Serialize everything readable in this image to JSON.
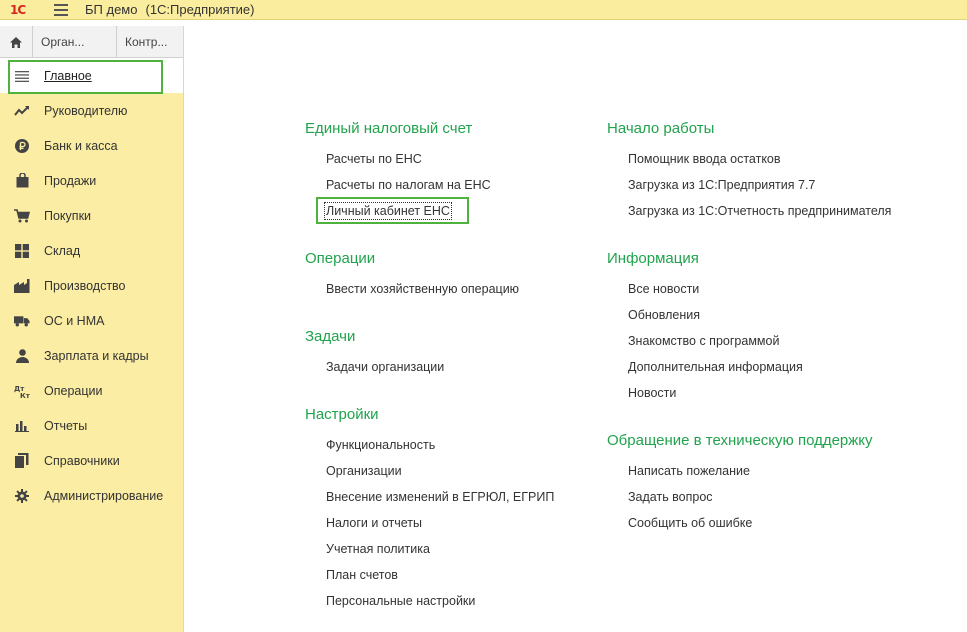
{
  "window": {
    "logo": "1С",
    "title": "БП демо",
    "subtitle": "(1С:Предприятие)"
  },
  "tabs": [
    {
      "label": "Орган..."
    },
    {
      "label": "Контр..."
    }
  ],
  "sidebar": {
    "items": [
      {
        "label": "Главное",
        "icon": "menu-lines-icon"
      },
      {
        "label": "Руководителю",
        "icon": "trend-chart-icon"
      },
      {
        "label": "Банк и касса",
        "icon": "ruble-coin-icon"
      },
      {
        "label": "Продажи",
        "icon": "shopping-bag-icon"
      },
      {
        "label": "Покупки",
        "icon": "shopping-cart-icon"
      },
      {
        "label": "Склад",
        "icon": "warehouse-grid-icon"
      },
      {
        "label": "Производство",
        "icon": "factory-icon"
      },
      {
        "label": "ОС и НМА",
        "icon": "truck-icon"
      },
      {
        "label": "Зарплата и кадры",
        "icon": "person-icon"
      },
      {
        "label": "Операции",
        "icon": "debit-credit-icon"
      },
      {
        "label": "Отчеты",
        "icon": "bar-chart-icon"
      },
      {
        "label": "Справочники",
        "icon": "books-icon"
      },
      {
        "label": "Администрирование",
        "icon": "gear-icon"
      }
    ]
  },
  "groups": {
    "ens": {
      "title": "Единый налоговый счет",
      "links": [
        "Расчеты по ЕНС",
        "Расчеты по налогам на ЕНС",
        "Личный кабинет ЕНС"
      ]
    },
    "operations": {
      "title": "Операции",
      "links": [
        "Ввести хозяйственную операцию"
      ]
    },
    "tasks": {
      "title": "Задачи",
      "links": [
        "Задачи организации"
      ]
    },
    "settings": {
      "title": "Настройки",
      "links": [
        "Функциональность",
        "Организации",
        "Внесение изменений в ЕГРЮЛ, ЕГРИП",
        "Налоги и отчеты",
        "Учетная политика",
        "План счетов",
        "Персональные настройки"
      ]
    },
    "start": {
      "title": "Начало работы",
      "links": [
        "Помощник ввода остатков",
        "Загрузка из 1С:Предприятия 7.7",
        "Загрузка из 1С:Отчетность предпринимателя"
      ]
    },
    "info": {
      "title": "Информация",
      "links": [
        "Все новости",
        "Обновления",
        "Знакомство с программой",
        "Дополнительная информация",
        "Новости"
      ]
    },
    "support": {
      "title": "Обращение в техническую поддержку",
      "links": [
        "Написать пожелание",
        "Задать вопрос",
        "Сообщить об ошибке"
      ]
    }
  },
  "colors": {
    "accent_green": "#21a34d",
    "highlight": "#4fb23c",
    "sidebar_bg": "#fbeda4",
    "titlebar_bg": "#fbed9e"
  }
}
